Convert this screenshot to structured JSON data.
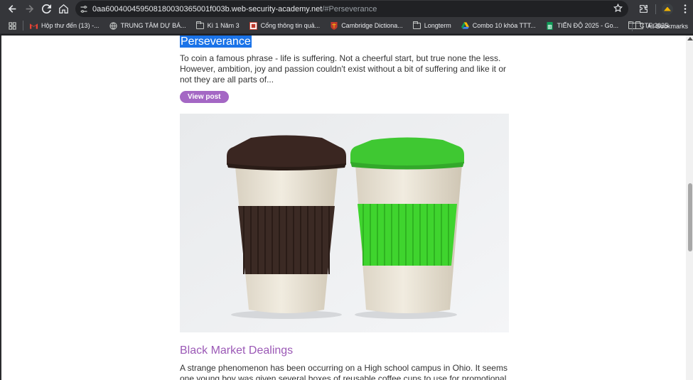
{
  "browser": {
    "url_host": "0aa600400459508180030365001f003b.web-security-academy.net",
    "url_path": "/#Perseverance",
    "bookmarks": [
      {
        "label": "Hộp thư đến (13) -...",
        "icon": "gmail-icon"
      },
      {
        "label": "TRUNG TÂM DỰ BÁ...",
        "icon": "globe-icon"
      },
      {
        "label": "Kì 1 Năm 3",
        "icon": "folder-icon"
      },
      {
        "label": "Cổng thông tin quả...",
        "icon": "site-icon"
      },
      {
        "label": "Cambridge Dictiona...",
        "icon": "cambridge-icon"
      },
      {
        "label": "Longterm",
        "icon": "folder-icon"
      },
      {
        "label": "Combo 10 khóa TTT...",
        "icon": "drive-icon"
      },
      {
        "label": "TIẾN ĐỘ 2025 - Go...",
        "icon": "sheets-icon"
      },
      {
        "label": "CTF 2025",
        "icon": "folder-icon"
      }
    ],
    "all_bookmarks_label": "All Bookmarks"
  },
  "page": {
    "post1": {
      "title": "Perseverance",
      "description": "To coin a famous phrase - life is suffering. Not a cheerful start, but true none the less. However, ambition, joy and passion couldn't exist without a bit of suffering and like it or not they are all parts of...",
      "button_label": "View post"
    },
    "post2": {
      "image_alt": "two reusable coffee cups",
      "title": "Black Market Dealings",
      "description": "A strange phenomenon has been occurring on a High school campus in Ohio. It seems one young boy was given several boxes of reusable coffee cups to use for promotional purposes. The boy"
    }
  },
  "colors": {
    "accent": "#a467c4",
    "title_link": "#9b59b6",
    "selection": "#1a73e8"
  }
}
